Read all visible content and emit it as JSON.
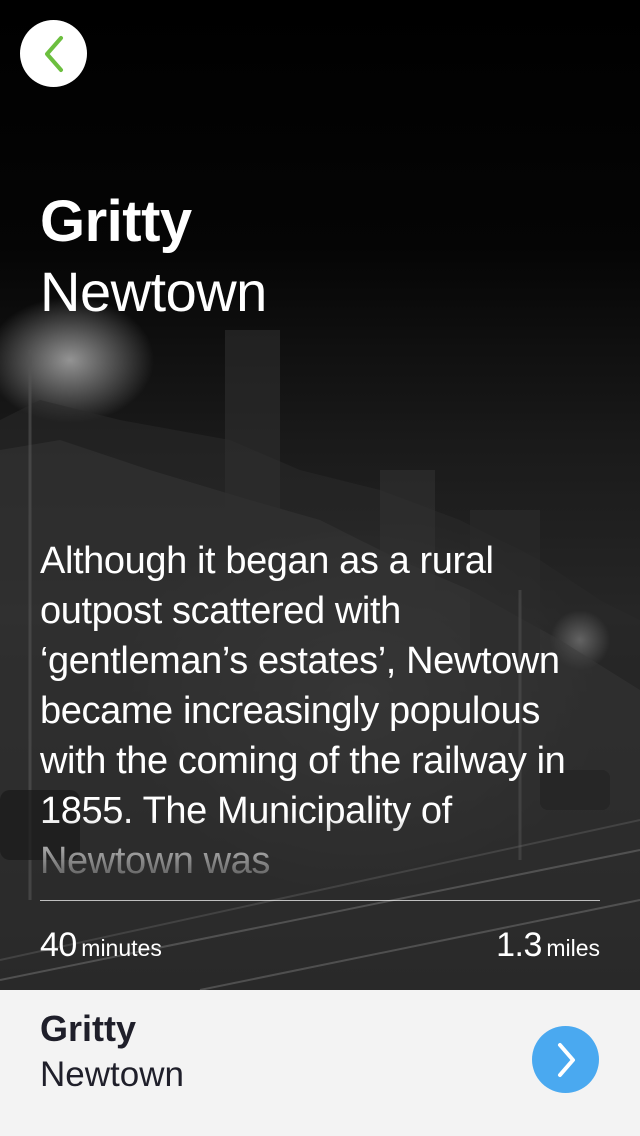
{
  "hero": {
    "title_bold": "Gritty",
    "title_light": "Newtown",
    "description": "Although it began as a rural outpost scattered with ‘gentleman’s estates’, Newtown became increasingly populous with the coming of the railway in 1855. The Municipality of Newtown was",
    "duration_value": "40",
    "duration_unit": "minutes",
    "distance_value": "1.3",
    "distance_unit": "miles",
    "background_image": "night-street-photo"
  },
  "nav": {
    "back_icon": "chevron-left-icon",
    "back_color": "#6cbf3f"
  },
  "footer": {
    "title_bold": "Gritty",
    "title_light": "Newtown",
    "next_icon": "chevron-right-icon",
    "next_color": "#4aa9f0"
  }
}
